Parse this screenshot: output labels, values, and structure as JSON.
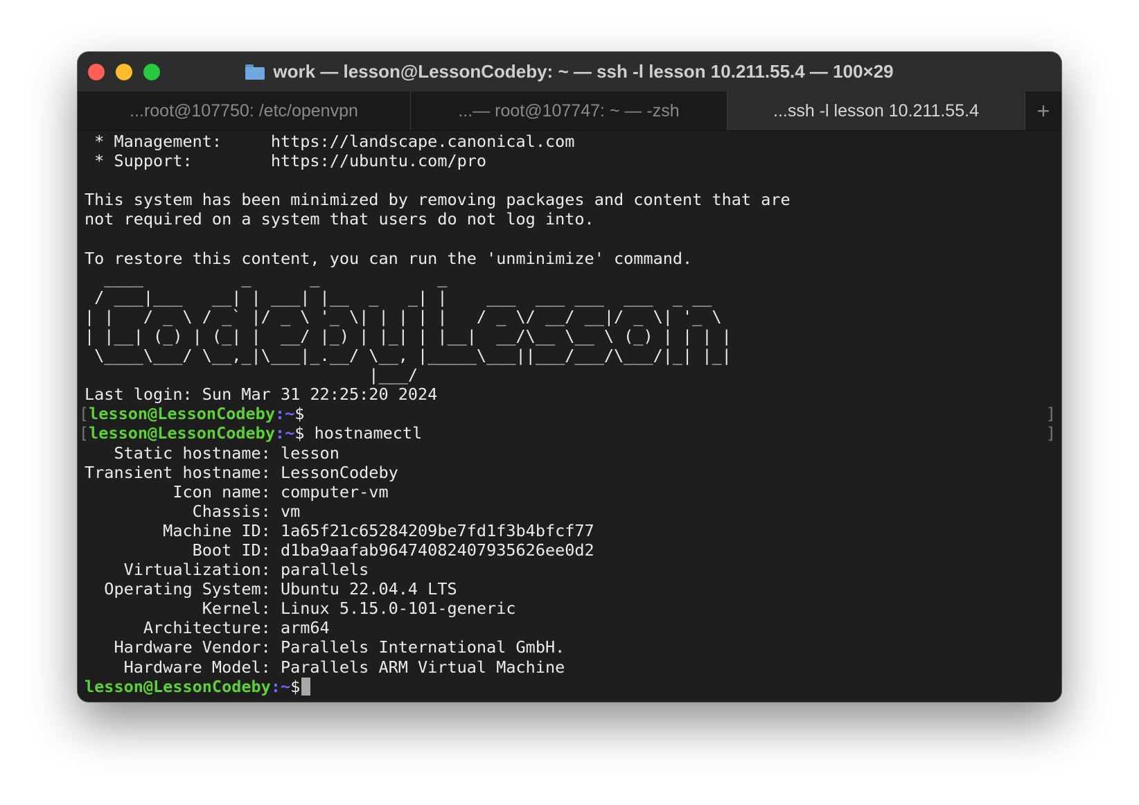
{
  "window": {
    "title": "work — lesson@LessonCodeby: ~ — ssh -l lesson 10.211.55.4 — 100×29",
    "folder_icon": "folder-icon"
  },
  "tabs": [
    {
      "label": "...root@107750: /etc/openvpn",
      "active": false
    },
    {
      "label": "...— root@107747: ~ — -zsh",
      "active": false
    },
    {
      "label": "...ssh -l lesson 10.211.55.4",
      "active": true
    }
  ],
  "new_tab_label": "+",
  "terminal": {
    "motd": [
      " * Management:     https://landscape.canonical.com",
      " * Support:        https://ubuntu.com/pro",
      "",
      "This system has been minimized by removing packages and content that are",
      "not required on a system that users do not log into.",
      "",
      "To restore this content, you can run the 'unminimize' command."
    ],
    "banner": [
      "  ____          _      _            _",
      " / ___|___   __| | ___| |__  _   _| |    ___  ___ ___  ___  _ __",
      "| |   / _ \\ / _` |/ _ \\ '_ \\| | | | |   / _ \\/ __/ __|/ _ \\| '_ \\",
      "| |__| (_) | (_| |  __/ |_) | |_| | |__|  __/\\__ \\__ \\ (_) | | | |",
      " \\____\\___/ \\__,_|\\___|_.__/ \\__, |_____\\___||___/___/\\___/|_| |_|",
      "                             |___/"
    ],
    "last_login": "Last login: Sun Mar 31 22:25:20 2024",
    "prompt_user": "lesson@LessonCodeby",
    "prompt_path": ":~",
    "prompt_sign": "$",
    "command": " hostnamectl",
    "hostnamectl": [
      "   Static hostname: lesson",
      "Transient hostname: LessonCodeby",
      "         Icon name: computer-vm",
      "           Chassis: vm",
      "        Machine ID: 1a65f21c65284209be7fd1f3b4bfcf77",
      "           Boot ID: d1ba9aafab96474082407935626ee0d2",
      "    Virtualization: parallels",
      "  Operating System: Ubuntu 22.04.4 LTS",
      "            Kernel: Linux 5.15.0-101-generic",
      "      Architecture: arm64",
      "   Hardware Vendor: Parallels International GmbH.",
      "    Hardware Model: Parallels ARM Virtual Machine"
    ],
    "bracket_left": "[",
    "bracket_right": "]"
  },
  "colors": {
    "prompt_user": "#5ed13a",
    "prompt_path": "#6b6bff",
    "background": "#1e1e1e"
  }
}
